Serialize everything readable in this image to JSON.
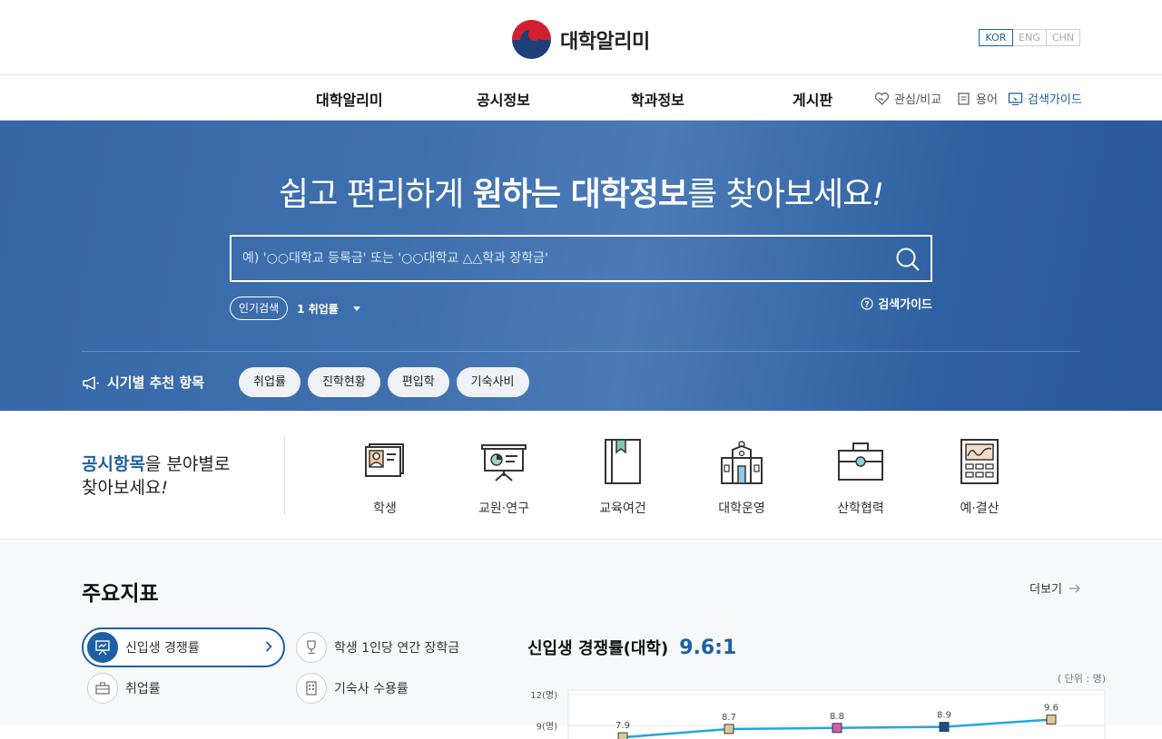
{
  "site": {
    "name": "대학알리미"
  },
  "languages": [
    {
      "label": "KOR",
      "active": true
    },
    {
      "label": "ENG",
      "active": false
    },
    {
      "label": "CHN",
      "active": false
    }
  ],
  "nav": {
    "items": [
      "대학알리미",
      "공시정보",
      "학과정보",
      "게시판"
    ],
    "utils": {
      "interest": "관심/비교",
      "glossary": "용어",
      "guide": "검색가이드"
    }
  },
  "hero": {
    "title_pre": "쉽고 편리하게 ",
    "title_bold": "원하는 대학정보",
    "title_post": "를 찾아보세요",
    "title_mark": "!",
    "search_placeholder": "예) '○○대학교 등록금' 또는 '○○대학교 △△학과 장학금'",
    "popular_label": "인기검색",
    "popular_keyword": "1 취업률",
    "guide_label": "검색가이드",
    "season_label": "시기별 추천 항목",
    "season_chips": [
      "취업률",
      "진학현황",
      "편입학",
      "기숙사비"
    ]
  },
  "category": {
    "title_bold": "공시항목",
    "title_rest": "을 분야별로",
    "title_line2": "찾아보세요",
    "title_mark": "!",
    "items": [
      {
        "label": "학생",
        "icon": "student-card-icon"
      },
      {
        "label": "교원·연구",
        "icon": "presentation-icon"
      },
      {
        "label": "교육여건",
        "icon": "book-icon"
      },
      {
        "label": "대학운영",
        "icon": "building-icon"
      },
      {
        "label": "산학협력",
        "icon": "briefcase-icon"
      },
      {
        "label": "예·결산",
        "icon": "calculator-icon"
      }
    ]
  },
  "indicators": {
    "title": "주요지표",
    "more": "더보기",
    "buttons": [
      {
        "label": "신입생 경쟁률",
        "active": true
      },
      {
        "label": "학생 1인당 연간 장학금",
        "active": false
      },
      {
        "label": "취업률",
        "active": false
      },
      {
        "label": "기숙사 수용률",
        "active": false
      }
    ],
    "chart_title": "신입생 경쟁률(대학)",
    "chart_value": "9.6:1",
    "unit": "( 단위 : 명)"
  },
  "chart_data": {
    "type": "line",
    "series": [
      {
        "values": [
          7.9,
          8.7,
          8.8,
          8.9,
          9.6
        ]
      }
    ],
    "point_colors": [
      "#e0c79b",
      "#e0c79b",
      "#d15db0",
      "#1f4f8a",
      "#e0c79b"
    ],
    "yticks": [
      "12(명)",
      "9(명)"
    ],
    "ylim": [
      0,
      12
    ],
    "line_color": "#22a6e0"
  }
}
